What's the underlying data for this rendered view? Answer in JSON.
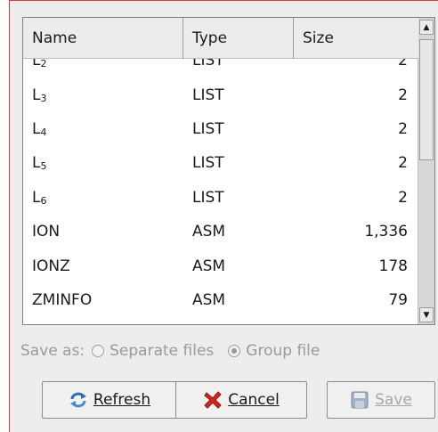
{
  "table": {
    "columns": [
      "Name",
      "Type",
      "Size"
    ],
    "rows": [
      {
        "name_base": "L",
        "name_sub": "3",
        "type": "LIST",
        "size": "2"
      },
      {
        "name_base": "L",
        "name_sub": "4",
        "type": "LIST",
        "size": "2"
      },
      {
        "name_base": "L",
        "name_sub": "5",
        "type": "LIST",
        "size": "2"
      },
      {
        "name_base": "L",
        "name_sub": "6",
        "type": "LIST",
        "size": "2"
      },
      {
        "name_base": "ION",
        "name_sub": "",
        "type": "ASM",
        "size": "1,336"
      },
      {
        "name_base": "IONZ",
        "name_sub": "",
        "type": "ASM",
        "size": "178"
      },
      {
        "name_base": "ZMINFO",
        "name_sub": "",
        "type": "ASM",
        "size": "79"
      }
    ]
  },
  "save_as": {
    "label": "Save as:",
    "option_separate": "Separate files",
    "option_group": "Group file",
    "selected": "group"
  },
  "buttons": {
    "refresh": "Refresh",
    "cancel": "Cancel",
    "save": "Save"
  },
  "colors": {
    "dialog_bg": "#ededed",
    "window_border": "#d23b3b",
    "disabled_text": "#9a9a9a"
  },
  "icons": {
    "refresh": "refresh-arrows-icon",
    "cancel": "red-x-icon",
    "save": "floppy-disk-icon",
    "scroll_up": "arrow-up-icon",
    "scroll_down": "arrow-down-icon"
  }
}
